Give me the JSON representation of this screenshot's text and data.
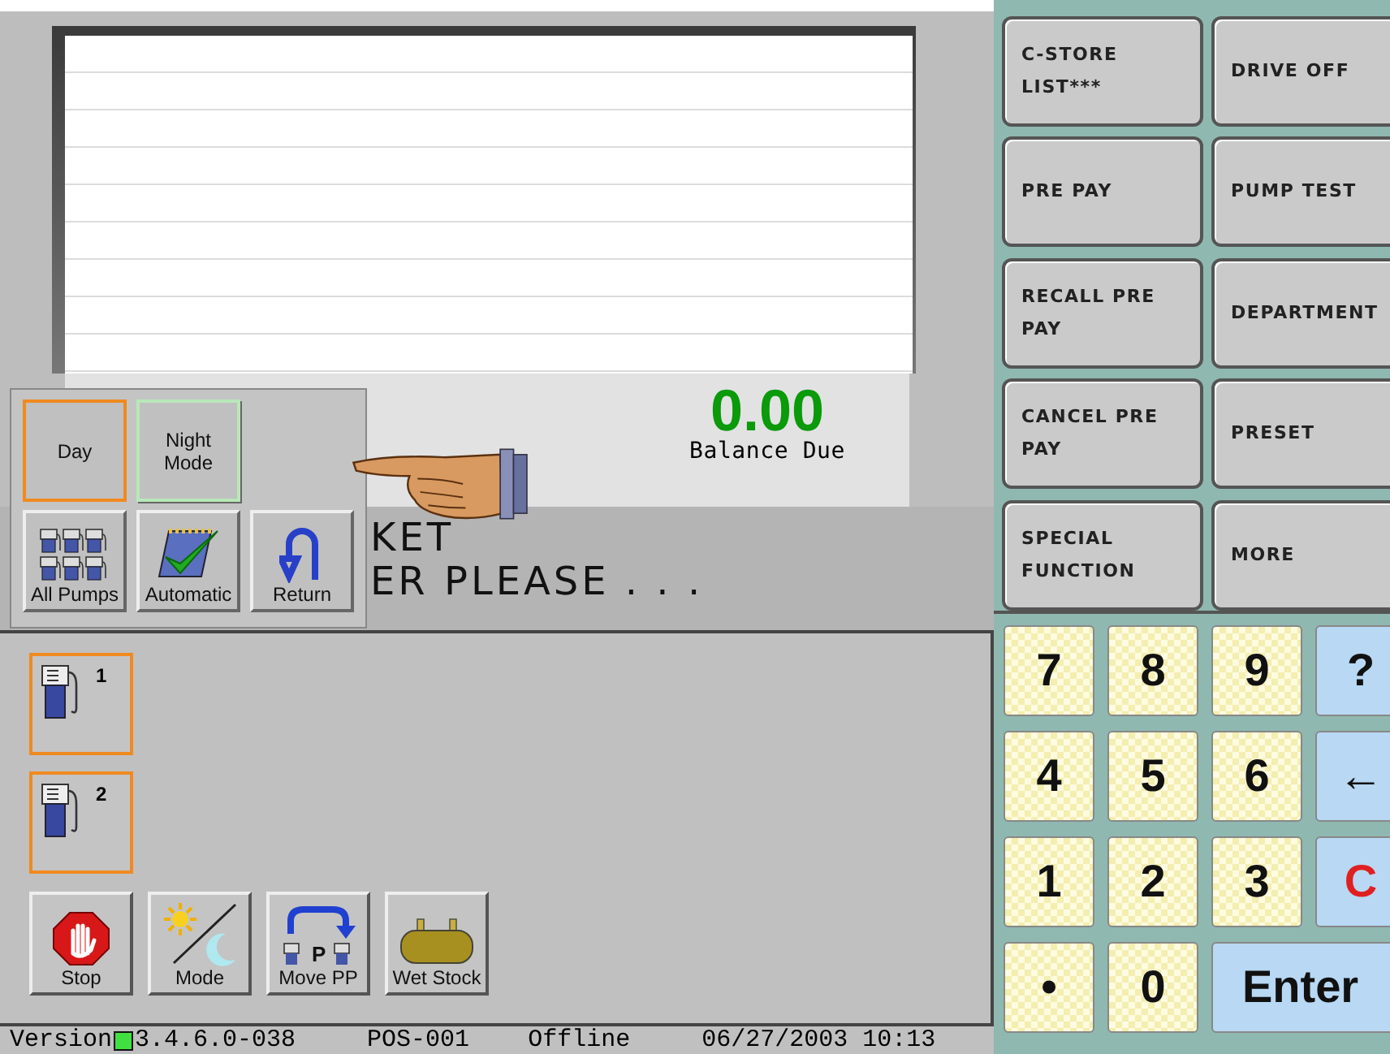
{
  "balance": {
    "amount": "0.00",
    "label": "Balance Due"
  },
  "message_lines": [
    "KET",
    "ER PLEASE . . ."
  ],
  "mode_popup": {
    "modes": [
      {
        "label": "Day",
        "selected": true
      },
      {
        "label": "Night Mode",
        "selected": false
      }
    ],
    "actions": [
      {
        "kind": "pumps",
        "label": "All Pumps"
      },
      {
        "kind": "auto",
        "label": "Automatic"
      },
      {
        "kind": "return",
        "label": "Return"
      }
    ]
  },
  "pumps": [
    {
      "number": "1",
      "selected": true
    },
    {
      "number": "2",
      "selected": true
    }
  ],
  "tools": [
    {
      "kind": "stop",
      "label": "Stop"
    },
    {
      "kind": "mode",
      "label": "Mode"
    },
    {
      "kind": "move",
      "label": "Move PP",
      "icon_text": "P"
    },
    {
      "kind": "tank",
      "label": "Wet Stock"
    }
  ],
  "status_bar": {
    "version_label": "Version",
    "online": true,
    "version": "3.4.6.0-038",
    "terminal": "POS-001",
    "connection": "Offline",
    "datetime": "06/27/2003 10:13"
  },
  "function_buttons": [
    "C-STORE LIST***",
    "DRIVE OFF",
    "PRE PAY",
    "PUMP TEST",
    "RECALL PRE PAY",
    "DEPARTMENT",
    "CANCEL PRE PAY",
    "PRESET",
    "SPECIAL FUNCTION",
    "MORE"
  ],
  "keypad": [
    {
      "kind": "digit",
      "label": "7"
    },
    {
      "kind": "digit",
      "label": "8"
    },
    {
      "kind": "digit",
      "label": "9"
    },
    {
      "kind": "action",
      "label": "?"
    },
    {
      "kind": "digit",
      "label": "4"
    },
    {
      "kind": "digit",
      "label": "5"
    },
    {
      "kind": "digit",
      "label": "6"
    },
    {
      "kind": "action",
      "label": "←"
    },
    {
      "kind": "digit",
      "label": "1"
    },
    {
      "kind": "digit",
      "label": "2"
    },
    {
      "kind": "digit",
      "label": "3"
    },
    {
      "kind": "clear",
      "label": "C"
    },
    {
      "kind": "digit",
      "label": "•"
    },
    {
      "kind": "digit",
      "label": "0"
    },
    {
      "kind": "enter",
      "label": "Enter"
    }
  ]
}
